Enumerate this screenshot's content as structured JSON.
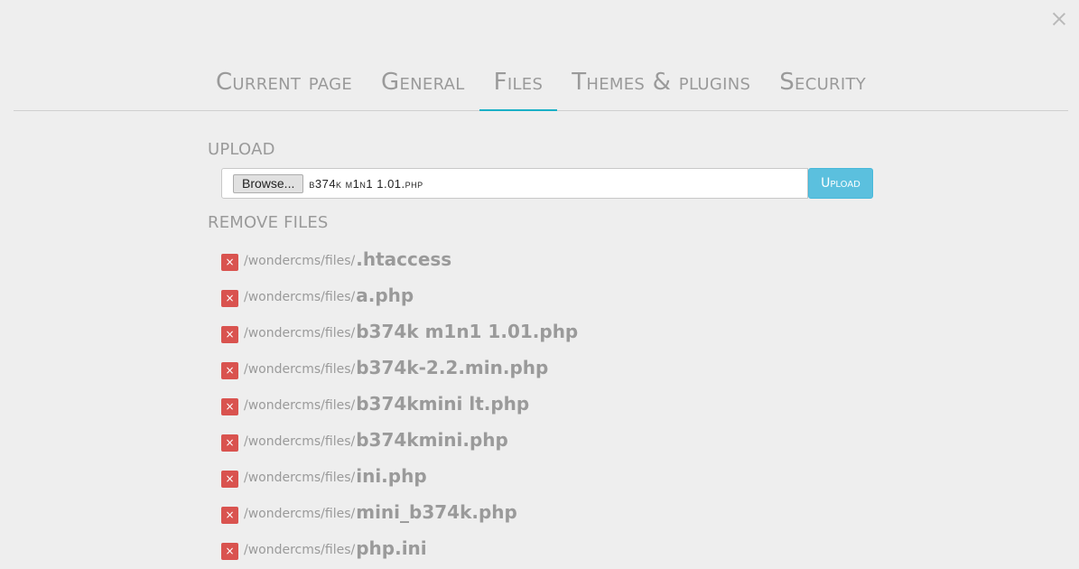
{
  "tabs": [
    {
      "label": "Current page",
      "active": false
    },
    {
      "label": "General",
      "active": false
    },
    {
      "label": "Files",
      "active": true
    },
    {
      "label": "Themes & plugins",
      "active": false
    },
    {
      "label": "Security",
      "active": false
    }
  ],
  "upload": {
    "section_label": "Upload",
    "browse_label": "Browse...",
    "selected_file": "b374k m1n1 1.01.php",
    "button_label": "Upload"
  },
  "remove": {
    "section_label": "Remove files",
    "files": [
      {
        "path": "/wondercms/files/",
        "name": ".htaccess",
        "delete_label": "×"
      },
      {
        "path": "/wondercms/files/",
        "name": "a.php",
        "delete_label": "×"
      },
      {
        "path": "/wondercms/files/",
        "name": "b374k m1n1 1.01.php",
        "delete_label": "×"
      },
      {
        "path": "/wondercms/files/",
        "name": "b374k-2.2.min.php",
        "delete_label": "×"
      },
      {
        "path": "/wondercms/files/",
        "name": "b374kmini lt.php",
        "delete_label": "×"
      },
      {
        "path": "/wondercms/files/",
        "name": "b374kmini.php",
        "delete_label": "×"
      },
      {
        "path": "/wondercms/files/",
        "name": "ini.php",
        "delete_label": "×"
      },
      {
        "path": "/wondercms/files/",
        "name": "mini_b374k.php",
        "delete_label": "×"
      },
      {
        "path": "/wondercms/files/",
        "name": "php.ini",
        "delete_label": "×"
      }
    ]
  },
  "colors": {
    "accent": "#1ab0c6",
    "upload_button": "#5bc0de",
    "delete_button": "#d9534f",
    "text_muted": "#9a9a9a",
    "background": "#eeeeee"
  },
  "icons": {
    "close": "close-icon",
    "delete": "times-icon"
  }
}
